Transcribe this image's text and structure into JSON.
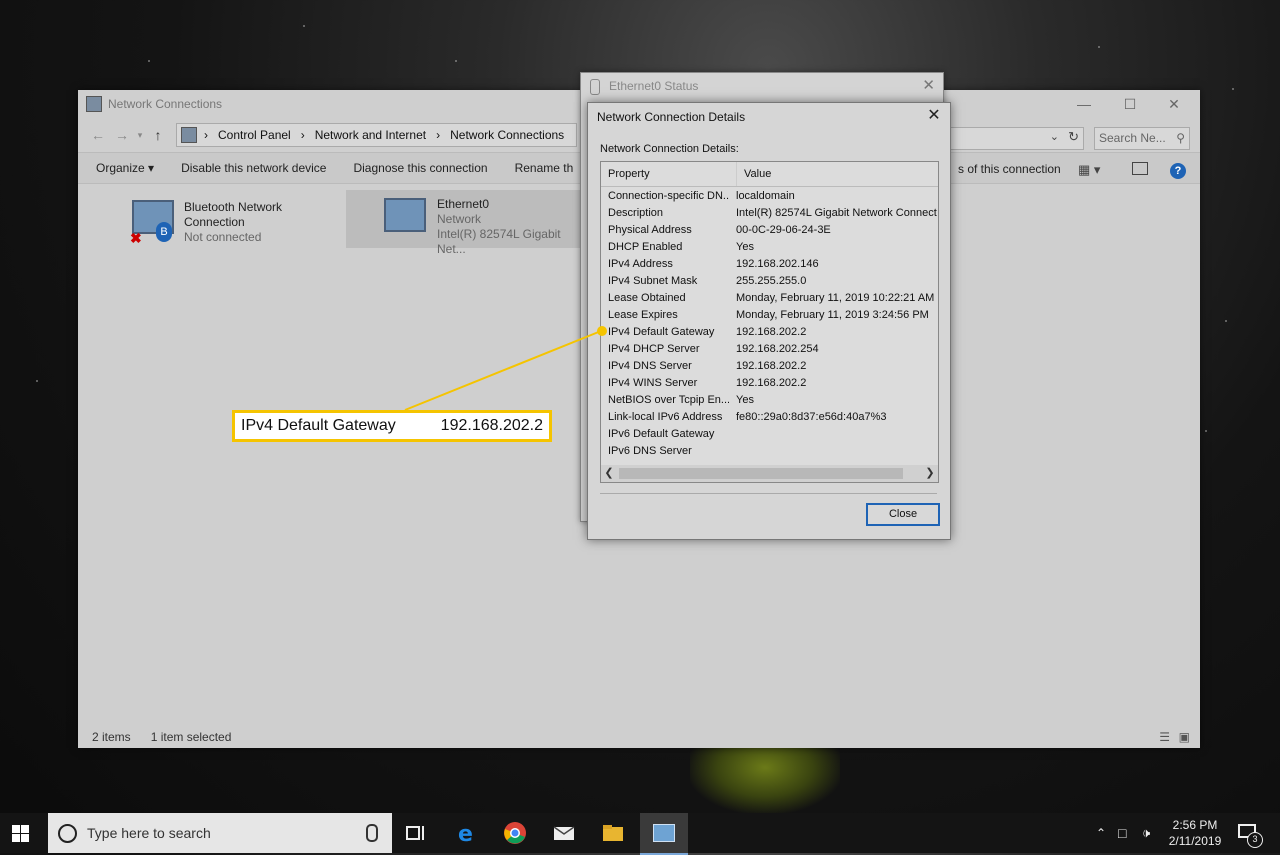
{
  "explorer": {
    "title": "Network Connections",
    "breadcrumb": [
      "Control Panel",
      "Network and Internet",
      "Network Connections"
    ],
    "search_placeholder": "Search Ne...",
    "commands": [
      "Organize ▾",
      "Disable this network device",
      "Diagnose this connection",
      "Rename th"
    ],
    "command_right": "s of this connection",
    "items": [
      {
        "name_line1": "Bluetooth Network",
        "name_line2": "Connection",
        "status": "Not connected"
      },
      {
        "name_line1": "Ethernet0",
        "name_line2": "Network",
        "status": "Intel(R) 82574L Gigabit Net..."
      }
    ],
    "status_items_count": "2 items",
    "status_selected": "1 item selected"
  },
  "status_dialog": {
    "title": "Ethernet0 Status"
  },
  "details_dialog": {
    "title": "Network Connection Details",
    "label": "Network Connection Details:",
    "col_property": "Property",
    "col_value": "Value",
    "rows": [
      {
        "property": "Connection-specific DN...",
        "value": "localdomain"
      },
      {
        "property": "Description",
        "value": "Intel(R) 82574L Gigabit Network Connect"
      },
      {
        "property": "Physical Address",
        "value": "00-0C-29-06-24-3E"
      },
      {
        "property": "DHCP Enabled",
        "value": "Yes"
      },
      {
        "property": "IPv4 Address",
        "value": "192.168.202.146"
      },
      {
        "property": "IPv4 Subnet Mask",
        "value": "255.255.255.0"
      },
      {
        "property": "Lease Obtained",
        "value": "Monday, February 11, 2019 10:22:21 AM"
      },
      {
        "property": "Lease Expires",
        "value": "Monday, February 11, 2019 3:24:56 PM"
      },
      {
        "property": "IPv4 Default Gateway",
        "value": "192.168.202.2"
      },
      {
        "property": "IPv4 DHCP Server",
        "value": "192.168.202.254"
      },
      {
        "property": "IPv4 DNS Server",
        "value": "192.168.202.2"
      },
      {
        "property": "IPv4 WINS Server",
        "value": "192.168.202.2"
      },
      {
        "property": "NetBIOS over Tcpip En...",
        "value": "Yes"
      },
      {
        "property": "Link-local IPv6 Address",
        "value": "fe80::29a0:8d37:e56d:40a7%3"
      },
      {
        "property": "IPv6 Default Gateway",
        "value": ""
      },
      {
        "property": "IPv6 DNS Server",
        "value": ""
      }
    ],
    "close_label": "Close"
  },
  "callout": {
    "label": "IPv4 Default Gateway",
    "value": "192.168.202.2",
    "color": "#f5c400"
  },
  "taskbar": {
    "search_placeholder": "Type here to search",
    "time": "2:56 PM",
    "date": "2/11/2019",
    "notification_count": "3"
  }
}
